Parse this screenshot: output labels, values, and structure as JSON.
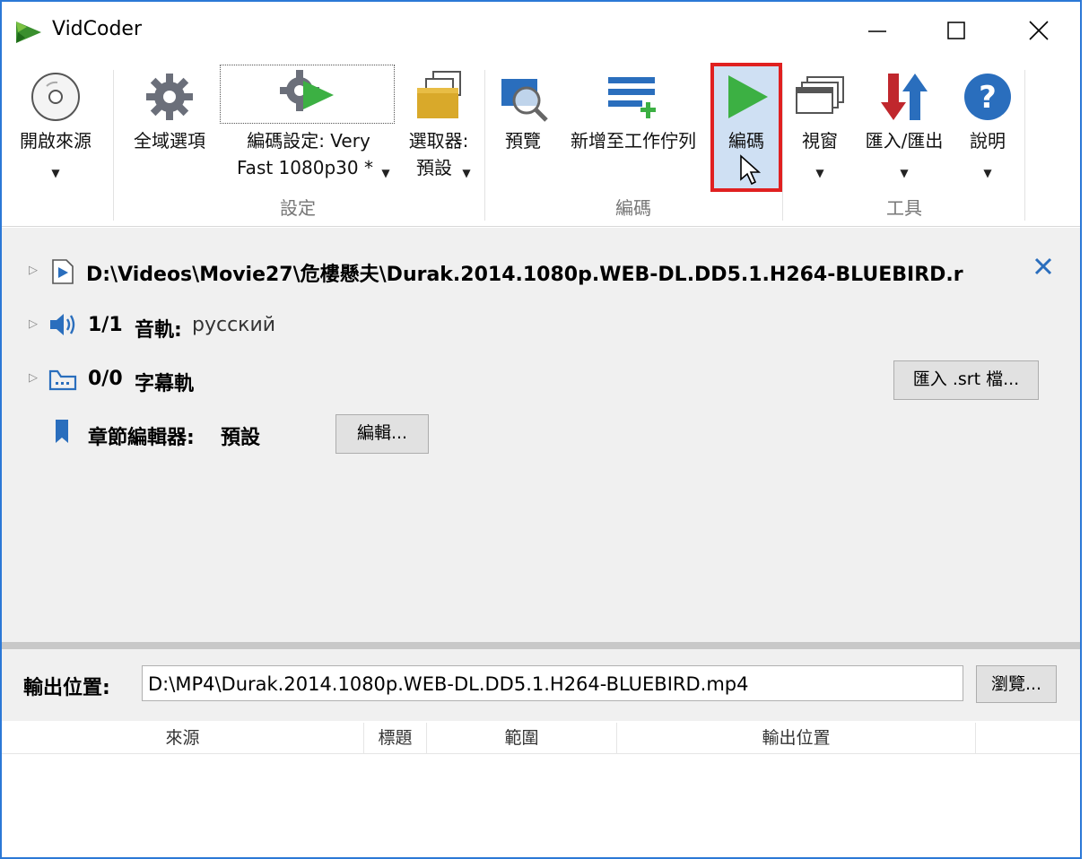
{
  "window": {
    "title": "VidCoder"
  },
  "ribbon": {
    "open_source": "開啟來源",
    "global_options": "全域選項",
    "encoding_settings_line1": "編碼設定: Very",
    "encoding_settings_line2": "Fast 1080p30 *",
    "picker_line1": "選取器:",
    "picker_line2": "預設",
    "preview": "預覽",
    "add_to_queue": "新增至工作佇列",
    "encode": "編碼",
    "window_menu": "視窗",
    "import_export": "匯入/匯出",
    "help": "說明",
    "group_settings": "設定",
    "group_encode": "編碼",
    "group_tools": "工具"
  },
  "source": {
    "path": "D:\\Videos\\Movie27\\危樓懸夫\\Durak.2014.1080p.WEB-DL.DD5.1.H264-BLUEBIRD.r",
    "audio_count": "1/1",
    "audio_label": "音軌:",
    "audio_value": "русский",
    "subtitle_count": "0/0",
    "subtitle_label": "字幕軌",
    "import_srt_button": "匯入 .srt 檔...",
    "chapter_label": "章節編輯器:",
    "chapter_value": "預設",
    "edit_button": "編輯..."
  },
  "output": {
    "label": "輸出位置:",
    "path": "D:\\MP4\\Durak.2014.1080p.WEB-DL.DD5.1.H264-BLUEBIRD.mp4",
    "browse_button": "瀏覽..."
  },
  "queue": {
    "columns": [
      "來源",
      "標題",
      "範圍",
      "輸出位置"
    ]
  },
  "colors": {
    "accent_blue": "#2b78d6",
    "encode_green": "#3cb043",
    "highlight_red": "#e02020"
  }
}
